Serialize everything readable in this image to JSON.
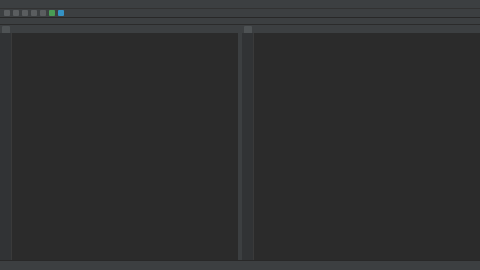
{
  "menubar": {
    "items": []
  },
  "navbar": {
    "crumbs": []
  },
  "left_editor": {
    "tab_title": "",
    "lines": []
  },
  "right_editor": {
    "tab_title": "",
    "lines": []
  },
  "statusbar": {
    "items": []
  },
  "colors": {
    "editor_background": "#2b2b2b",
    "chrome_background": "#3c3f41",
    "gutter_background": "#313335",
    "default_text": "#a9b7c6"
  }
}
